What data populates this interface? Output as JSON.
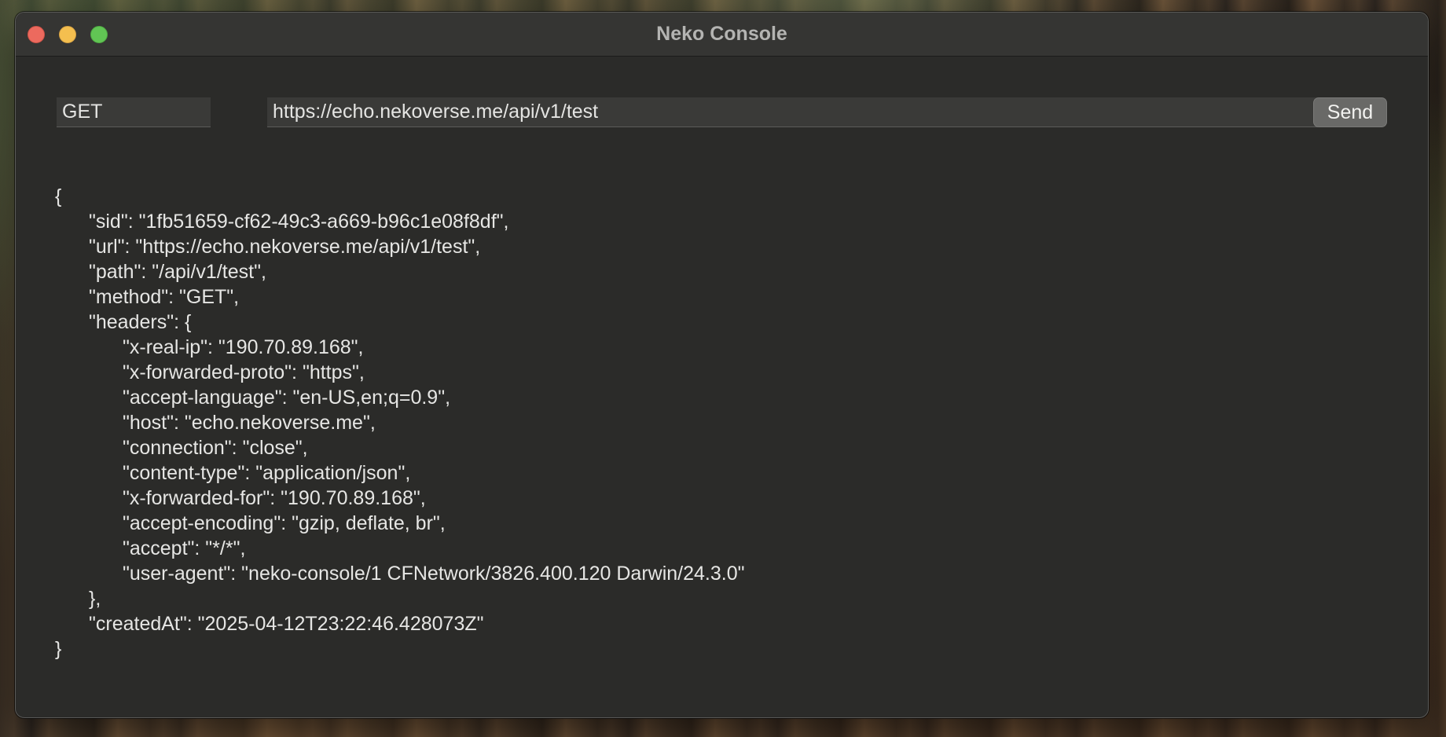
{
  "window": {
    "title": "Neko Console"
  },
  "request": {
    "method": "GET",
    "url": "https://echo.nekoverse.me/api/v1/test",
    "send_label": "Send"
  },
  "response": {
    "lines": [
      "{",
      "\"sid\": \"1fb51659-cf62-49c3-a669-b96c1e08f8df\",",
      "\"url\": \"https://echo.nekoverse.me/api/v1/test\",",
      "\"path\": \"/api/v1/test\",",
      "\"method\": \"GET\",",
      "\"headers\": {",
      "\"x-real-ip\": \"190.70.89.168\",",
      "\"x-forwarded-proto\": \"https\",",
      "\"accept-language\": \"en-US,en;q=0.9\",",
      "\"host\": \"echo.nekoverse.me\",",
      "\"connection\": \"close\",",
      "\"content-type\": \"application/json\",",
      "\"x-forwarded-for\": \"190.70.89.168\",",
      "\"accept-encoding\": \"gzip, deflate, br\",",
      "\"accept\": \"*/*\",",
      "\"user-agent\": \"neko-console/1 CFNetwork/3826.400.120 Darwin/24.3.0\"",
      "},",
      "\"createdAt\": \"2025-04-12T23:22:46.428073Z\"",
      "}"
    ]
  },
  "colors": {
    "window_bg": "#2b2b29",
    "titlebar_bg": "#353533",
    "close": "#ec6a5e",
    "minimize": "#f4bf4f",
    "zoom": "#61c554"
  }
}
